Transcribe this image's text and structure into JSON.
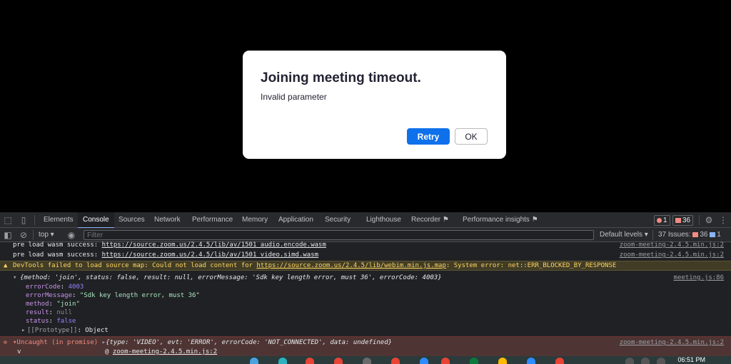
{
  "dialog": {
    "title": "Joining meeting timeout.",
    "message": "Invalid parameter",
    "retry_label": "Retry",
    "ok_label": "OK"
  },
  "devtools": {
    "tabs": [
      "Elements",
      "Console",
      "Sources",
      "Network",
      "Performance",
      "Memory",
      "Application",
      "Security",
      "Lighthouse",
      "Recorder ⚑",
      "Performance insights ⚑"
    ],
    "active_tab": "Console",
    "error_count": "1",
    "issue_count": "36",
    "toolbar": {
      "context": "top ▾",
      "filter_placeholder": "Filter",
      "levels": "Default levels ▾",
      "issues_label": "37 Issues:",
      "issues_errors": "36",
      "issues_info": "1"
    },
    "console": {
      "line1_prefix": "pre load wasm success: ",
      "line1_url": "https://source.zoom.us/2.4.5/lib/av/1501_audio.encode.wasm",
      "line1_src": "zoom-meeting-2.4.5.min.js:2",
      "line2_prefix": "pre load wasm success: ",
      "line2_url": "https://source.zoom.us/2.4.5/lib/av/1501_video.simd.wasm",
      "line2_src": "zoom-meeting-2.4.5.min.js:2",
      "warn_prefix": "DevTools failed to load source map: Could not load content for ",
      "warn_url": "https://source.zoom.us/2.4.5/lib/webim.min.js.map",
      "warn_suffix": ": System error: net::ERR_BLOCKED_BY_RESPONSE",
      "obj_summary": "{method: 'join', status: false, result: null, errorMessage: 'Sdk key length error, must 36', errorCode: 4003}",
      "obj_src": "meeting.js:86",
      "errorCode_key": "errorCode",
      "errorCode_val": "4003",
      "errorMessage_key": "errorMessage",
      "errorMessage_val": "\"Sdk key length error, must 36\"",
      "method_key": "method",
      "method_val": "\"join\"",
      "result_key": "result",
      "result_val": "null",
      "status_key": "status",
      "status_val": "false",
      "proto_key": "[[Prototype]]",
      "proto_val": "Object",
      "err_label": "Uncaught (in promise)",
      "err_summary": "{type: 'VIDEO', evt: 'ERROR', errorCode: 'NOT_CONNECTED', data: undefined}",
      "err_src": "zoom-meeting-2.4.5.min.js:2",
      "err_trace": "zoom-meeting-2.4.5.min.js:2"
    }
  },
  "taskbar": {
    "clock": "06:51 PM"
  }
}
